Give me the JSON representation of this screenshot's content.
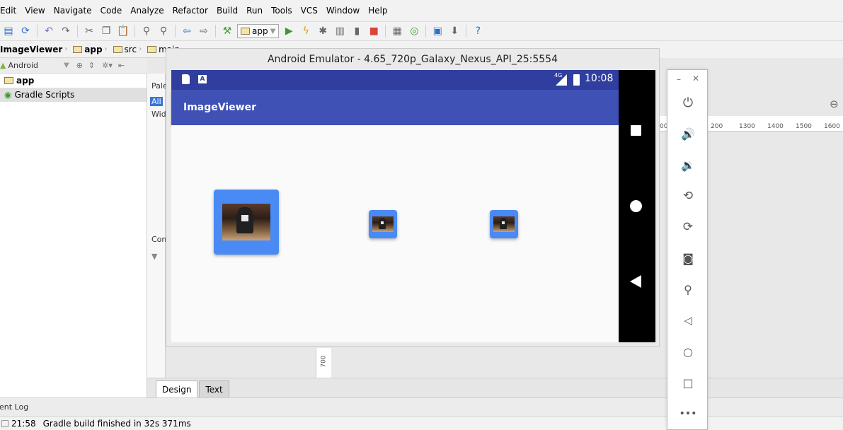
{
  "menu": [
    "Edit",
    "View",
    "Navigate",
    "Code",
    "Analyze",
    "Refactor",
    "Build",
    "Run",
    "Tools",
    "VCS",
    "Window",
    "Help"
  ],
  "toolbar": {
    "run_config": "app"
  },
  "breadcrumb": [
    "ImageViewer",
    "app",
    "src",
    "main"
  ],
  "project": {
    "view_mode": "Android",
    "items": [
      {
        "label": "app",
        "bold": true
      },
      {
        "label": "Gradle Scripts",
        "bold": false
      }
    ]
  },
  "palette": {
    "header": "Pale",
    "tab_all": "All",
    "tab_widgets": "Wid",
    "component_tree": "Com"
  },
  "ruler": {
    "top_ticks": [
      "00",
      "200",
      "1300",
      "1400",
      "1500",
      "1600"
    ],
    "left_tick": "700"
  },
  "design_tabs": [
    "Design",
    "Text"
  ],
  "emulator": {
    "title": "Android Emulator - 4.65_720p_Galaxy_Nexus_API_25:5554",
    "status_time": "10:08",
    "network": "4G",
    "app_title": "ImageViewer"
  },
  "event_log_label": "ent Log",
  "status": {
    "time": "21:58",
    "message": "Gradle build finished in 32s 371ms"
  },
  "colors": {
    "primary": "#3f51b5",
    "primary_dark": "#303f9f",
    "accent": "#4a8af4"
  }
}
